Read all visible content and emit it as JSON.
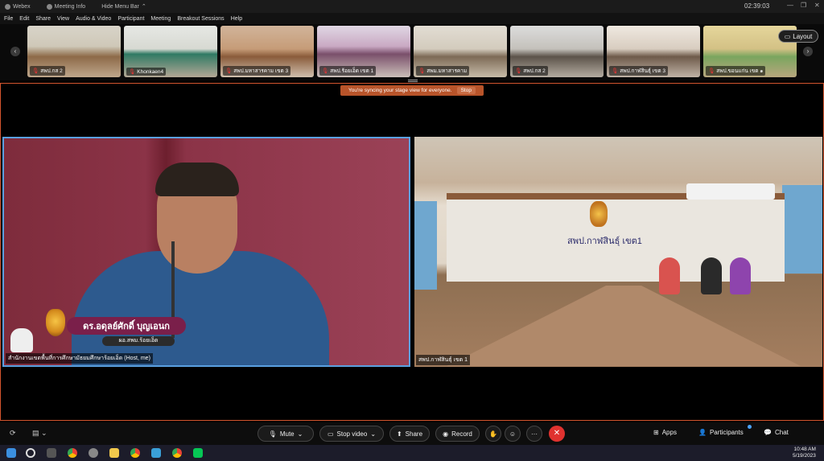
{
  "titlebar": {
    "app_name": "Webex",
    "meeting_info": "Meeting Info",
    "hide_menu_bar": "Hide Menu Bar",
    "timer": "02:39:03"
  },
  "menu": [
    "File",
    "Edit",
    "Share",
    "View",
    "Audio & Video",
    "Participant",
    "Meeting",
    "Breakout Sessions",
    "Help"
  ],
  "filmstrip": {
    "tiles": [
      {
        "label": "สพป.กส 2"
      },
      {
        "label": "Khonkaen4"
      },
      {
        "label": "สพป.มหาสารคาม เขต 3"
      },
      {
        "label": "สพป.ร้อยเอ็ด เขต 1"
      },
      {
        "label": "สพม.มหาสารคาม"
      },
      {
        "label": "สพป.กส 2"
      },
      {
        "label": "สพป.กาฬสินธุ์ เขต 3"
      },
      {
        "label": "สพป.ขอนแก่น เขต ๑"
      }
    ],
    "layout_label": "Layout"
  },
  "banner": {
    "text": "You're syncing your stage view for everyone.",
    "stop": "Stop"
  },
  "stage": {
    "left": {
      "name_badge": "ดร.อดุลย์ศักดิ์ บุญเอนก",
      "name_sub": "ผอ.สพม.ร้อยเอ็ด",
      "caption": "สำนักงานเขตพื้นที่การศึกษามัธยมศึกษาร้อยเอ็ด (Host, me)"
    },
    "right": {
      "room_sign": "สพป.กาฬสินธุ์ เขต1",
      "caption": "สพป.กาฬสินธุ์ เขต 1"
    }
  },
  "controls": {
    "mute": "Mute",
    "stop_video": "Stop video",
    "share": "Share",
    "record": "Record",
    "more": "···",
    "end": "✕",
    "apps": "Apps",
    "participants": "Participants",
    "chat": "Chat"
  },
  "taskbar": {
    "time": "10:48 AM",
    "date": "5/19/2023"
  }
}
